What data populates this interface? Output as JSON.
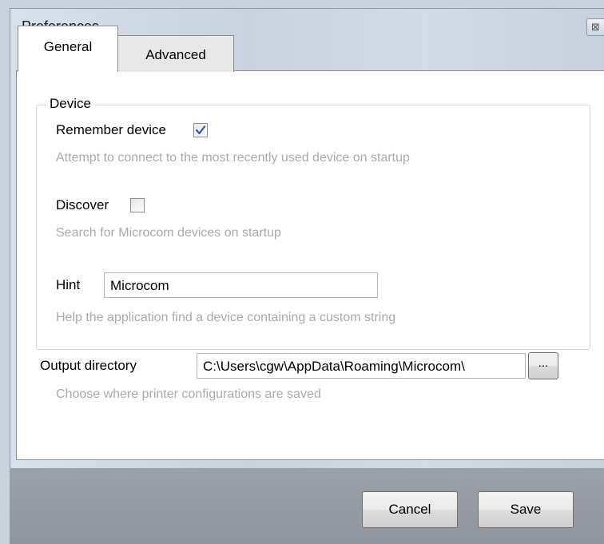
{
  "window": {
    "title": "Preferences",
    "close_glyph": "⊠"
  },
  "tabs": [
    {
      "label": "General",
      "selected": true
    },
    {
      "label": "Advanced",
      "selected": false
    }
  ],
  "device_group": {
    "label": "Device",
    "remember_device": {
      "label": "Remember device",
      "checked": true,
      "hint": "Attempt to connect to the most recently used device on startup"
    },
    "discover": {
      "label": "Discover",
      "checked": false,
      "hint": "Search for Microcom devices on startup"
    },
    "hint_field": {
      "label": "Hint",
      "value": "Microcom",
      "hint": "Help the application find a device containing a custom string"
    }
  },
  "output_directory": {
    "label": "Output directory",
    "value": "C:\\Users\\cgw\\AppData\\Roaming\\Microcom\\",
    "browse_label": "...",
    "hint": "Choose where printer configurations are saved"
  },
  "footer": {
    "cancel_label": "Cancel",
    "save_label": "Save"
  },
  "colors": {
    "checkmark": "#2a59b4",
    "hint_text": "#a9a9a9",
    "footer_bg": "#969da4"
  }
}
